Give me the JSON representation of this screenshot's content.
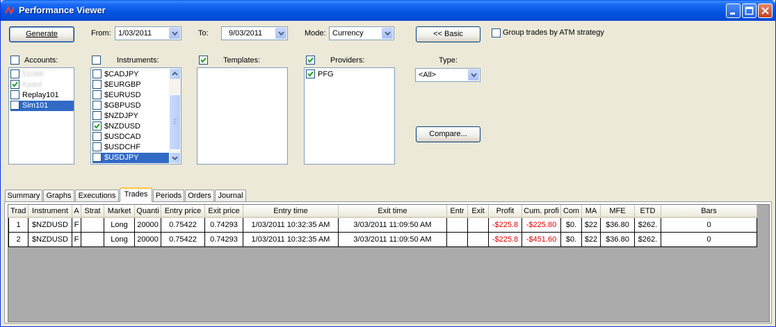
{
  "window": {
    "title": "Performance Viewer"
  },
  "toolbar": {
    "generate_label": "Generate",
    "from_label": "From:",
    "from_value": "1/03/2011",
    "to_label": "To:",
    "to_value": "9/03/2011",
    "mode_label": "Mode:",
    "mode_value": "Currency",
    "basic_label": "<< Basic",
    "group_trades_label": "Group trades by ATM strategy",
    "compare_label": "Compare...",
    "type_label": "Type:",
    "type_value": "<All>"
  },
  "accounts": {
    "header": "Accounts:",
    "items": [
      {
        "label": "51066",
        "checked": false,
        "blurred": true
      },
      {
        "label": "Kpaol",
        "checked": true,
        "blurred": true
      },
      {
        "label": "Replay101",
        "checked": false,
        "blurred": false
      },
      {
        "label": "Sim101",
        "checked": false,
        "blurred": false,
        "selected": true
      }
    ]
  },
  "instruments": {
    "header": "Instruments:",
    "items": [
      {
        "label": "$CADJPY",
        "checked": false
      },
      {
        "label": "$EURGBP",
        "checked": false
      },
      {
        "label": "$EURUSD",
        "checked": false
      },
      {
        "label": "$GBPUSD",
        "checked": false
      },
      {
        "label": "$NZDJPY",
        "checked": false
      },
      {
        "label": "$NZDUSD",
        "checked": true
      },
      {
        "label": "$USDCAD",
        "checked": false
      },
      {
        "label": "$USDCHF",
        "checked": false
      },
      {
        "label": "$USDJPY",
        "checked": false,
        "selected": true
      }
    ]
  },
  "templates": {
    "header": "Templates:",
    "checked": true
  },
  "providers": {
    "header": "Providers:",
    "checked": true,
    "items": [
      {
        "label": "PFG",
        "checked": true
      }
    ]
  },
  "tabs": [
    "Summary",
    "Graphs",
    "Executions",
    "Trades",
    "Periods",
    "Orders",
    "Journal"
  ],
  "active_tab": "Trades",
  "grid": {
    "columns": [
      "Trad",
      "Instrument",
      "A",
      "Strat",
      "Market",
      "Quanti",
      "Entry price",
      "Exit price",
      "Entry time",
      "Exit time",
      "Entr",
      "Exit",
      "Profit",
      "Cum. profi",
      "Com",
      "MA",
      "MFE",
      "ETD",
      "Bars"
    ],
    "rows": [
      [
        "1",
        "$NZDUSD",
        "F",
        "",
        "Long",
        "20000",
        "0.75422",
        "0.74293",
        "1/03/2011 10:32:35 AM",
        "3/03/2011 11:09:50 AM",
        "",
        "",
        "-$225.8",
        "-$225.80",
        "$0.",
        "$22",
        "$36.80",
        "$262.",
        "0"
      ],
      [
        "2",
        "$NZDUSD",
        "F",
        "",
        "Long",
        "20000",
        "0.75422",
        "0.74293",
        "1/03/2011 10:32:35 AM",
        "3/03/2011 11:09:50 AM",
        "",
        "",
        "-$225.8",
        "-$451.60",
        "$0.",
        "$22",
        "$36.80",
        "$262.",
        "0"
      ]
    ]
  },
  "colors": {
    "title_bar": "#0454e1",
    "selection": "#316ac5",
    "negative": "#e00000",
    "active_tab_accent": "#ffc83c"
  }
}
